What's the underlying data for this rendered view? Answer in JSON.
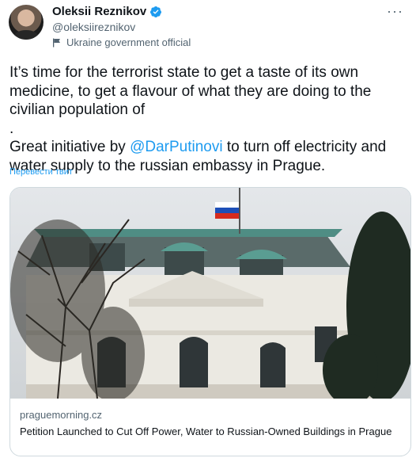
{
  "author": {
    "name": "Oleksii Reznikov",
    "handle": "@oleksiireznikov",
    "label": "Ukraine government official"
  },
  "more_icon": "more-horizontal-icon",
  "tweet": {
    "line1": "It’s time for the terrorist state to get a taste of its own medicine, to get a flavour of what they are doing to the civilian population of",
    "line1_end": ".",
    "line2_pre": "Great initiative by ",
    "mention": "@DarPutinovi",
    "line2_post": " to turn off electricity and water supply to the russian embassy in Prague."
  },
  "translate_label": "Перевести твит",
  "card": {
    "domain": "praguemorning.cz",
    "title": "Petition Launched to Cut Off Power, Water to Russian-Owned Buildings in Prague"
  },
  "colors": {
    "accent": "#1d9bf0",
    "secondary_text": "#536471",
    "ukraine_blue": "#0057b7",
    "ukraine_yellow": "#ffd700"
  }
}
